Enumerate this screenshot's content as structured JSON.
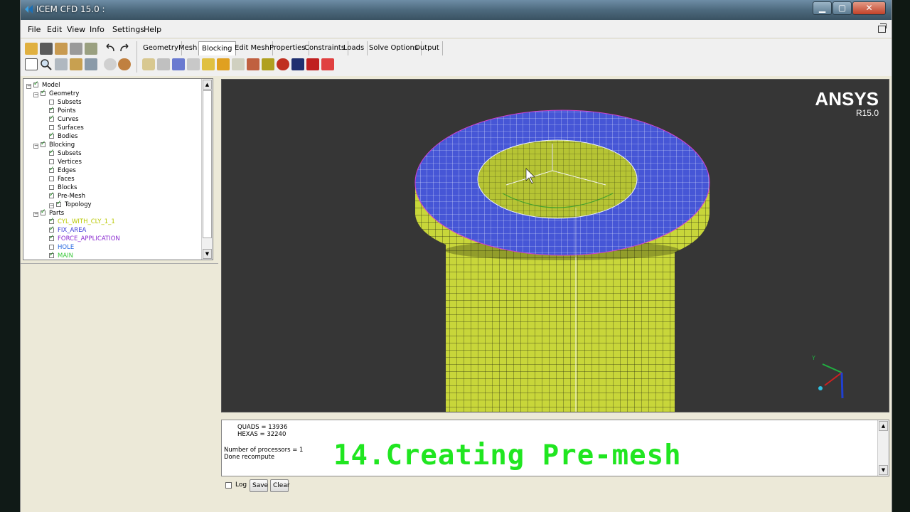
{
  "window": {
    "title": "ICEM CFD 15.0 :"
  },
  "menu": [
    "File",
    "Edit",
    "View",
    "Info",
    "Settings",
    "Help"
  ],
  "tabs": [
    "Geometry",
    "Mesh",
    "Blocking",
    "Edit Mesh",
    "Properties",
    "Constraints",
    "Loads",
    "Solve Options",
    "Output"
  ],
  "active_tab": "Blocking",
  "tree": [
    {
      "label": "Model",
      "checked": true,
      "level": 0,
      "expand": true
    },
    {
      "label": "Geometry",
      "checked": true,
      "level": 1,
      "expand": true
    },
    {
      "label": "Subsets",
      "checked": false,
      "level": 2
    },
    {
      "label": "Points",
      "checked": true,
      "level": 2
    },
    {
      "label": "Curves",
      "checked": true,
      "level": 2
    },
    {
      "label": "Surfaces",
      "checked": false,
      "level": 2
    },
    {
      "label": "Bodies",
      "checked": true,
      "level": 2
    },
    {
      "label": "Blocking",
      "checked": true,
      "level": 1,
      "expand": true
    },
    {
      "label": "Subsets",
      "checked": true,
      "level": 2
    },
    {
      "label": "Vertices",
      "checked": false,
      "level": 2
    },
    {
      "label": "Edges",
      "checked": true,
      "level": 2
    },
    {
      "label": "Faces",
      "checked": false,
      "level": 2
    },
    {
      "label": "Blocks",
      "checked": false,
      "level": 2
    },
    {
      "label": "Pre-Mesh",
      "checked": true,
      "level": 2
    },
    {
      "label": "Topology",
      "checked": true,
      "level": 2,
      "expand": true
    },
    {
      "label": "Parts",
      "checked": true,
      "level": 1,
      "expand": true
    },
    {
      "label": "CYL_WITH_CLY_1_1",
      "checked": true,
      "level": 2,
      "color": "#b8c800"
    },
    {
      "label": "FIX_AREA",
      "checked": true,
      "level": 2,
      "color": "#3a3ad8"
    },
    {
      "label": "FORCE_APPLICATION",
      "checked": true,
      "level": 2,
      "color": "#8a2ad0"
    },
    {
      "label": "HOLE",
      "checked": false,
      "level": 2,
      "color": "#2a6ae0"
    },
    {
      "label": "MAIN",
      "checked": true,
      "level": 2,
      "color": "#3ac83a"
    }
  ],
  "viewport": {
    "logo": "ANSYS",
    "revision": "R15.0",
    "background": "#363636",
    "mesh_color": "#c8d63a",
    "cap_color": "#4a5ad8"
  },
  "messages": {
    "quads": "QUADS = 13936",
    "hexas": "HEXAS = 32240",
    "processors": "Number of processors = 1",
    "done": "Done recompute"
  },
  "caption": "14.Creating Pre-mesh",
  "bottom": {
    "log_label": "Log",
    "save_label": "Save",
    "clear_label": "Clear"
  }
}
